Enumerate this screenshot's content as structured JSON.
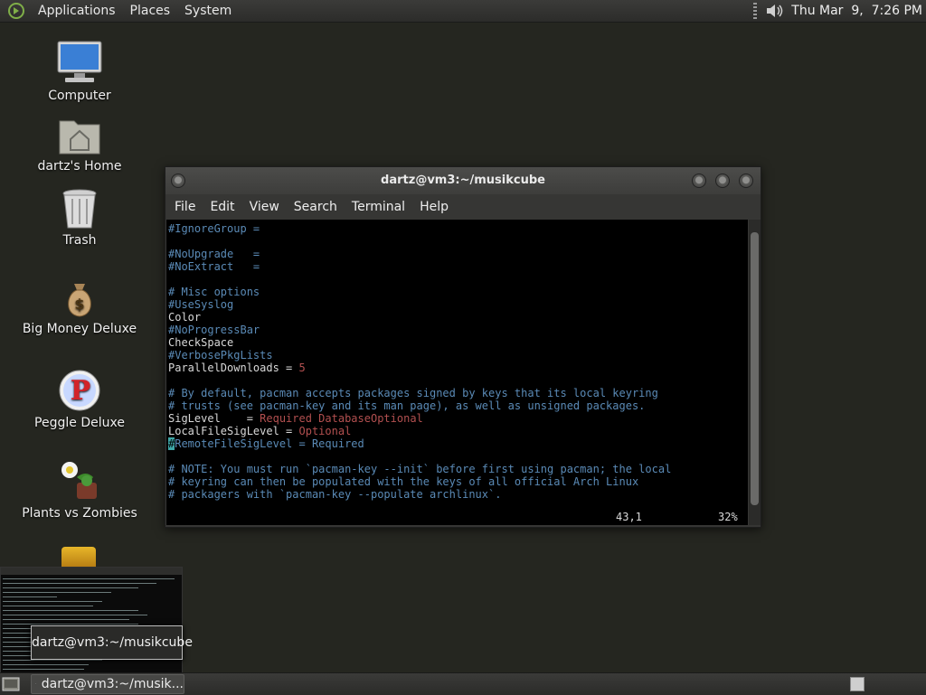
{
  "top_panel": {
    "menus": [
      "Applications",
      "Places",
      "System"
    ],
    "clock": "Thu Mar  9,  7:26 PM",
    "icons": [
      "gnome-foot-icon",
      "volume-icon"
    ]
  },
  "desktop": {
    "icons": [
      {
        "label": "Computer",
        "icon": "computer-icon"
      },
      {
        "label": "dartz's Home",
        "icon": "home-folder-icon"
      },
      {
        "label": "Trash",
        "icon": "trash-icon"
      },
      {
        "label": "Big Money Deluxe",
        "icon": "money-bag-icon"
      },
      {
        "label": "Peggle Deluxe",
        "icon": "peggle-icon"
      },
      {
        "label": "Plants vs Zombies",
        "icon": "plants-vs-zombies-icon"
      }
    ]
  },
  "terminal": {
    "title": "dartz@vm3:~/musikcube",
    "menus": [
      "File",
      "Edit",
      "View",
      "Search",
      "Terminal",
      "Help"
    ],
    "lines": [
      {
        "t": "#IgnoreGroup =",
        "c": "blue"
      },
      {
        "t": "",
        "c": "blue"
      },
      {
        "t": "#NoUpgrade   =",
        "c": "blue"
      },
      {
        "t": "#NoExtract   =",
        "c": "blue"
      },
      {
        "t": "",
        "c": "blue"
      },
      {
        "t": "# Misc options",
        "c": "blue"
      },
      {
        "t": "#UseSyslog",
        "c": "blue"
      },
      {
        "t": "Color",
        "c": "white"
      },
      {
        "t": "#NoProgressBar",
        "c": "blue"
      },
      {
        "t": "CheckSpace",
        "c": "white"
      },
      {
        "t": "#VerbosePkgLists",
        "c": "blue"
      },
      {
        "parts": [
          {
            "t": "ParallelDownloads = ",
            "c": "white"
          },
          {
            "t": "5",
            "c": "red"
          }
        ]
      },
      {
        "t": "",
        "c": "blue"
      },
      {
        "t": "# By default, pacman accepts packages signed by keys that its local keyring",
        "c": "blue"
      },
      {
        "t": "# trusts (see pacman-key and its man page), as well as unsigned packages.",
        "c": "blue"
      },
      {
        "parts": [
          {
            "t": "SigLevel    = ",
            "c": "white"
          },
          {
            "t": "Required DatabaseOptional",
            "c": "red"
          }
        ]
      },
      {
        "parts": [
          {
            "t": "LocalFileSigLevel = ",
            "c": "white"
          },
          {
            "t": "Optional",
            "c": "red"
          }
        ]
      },
      {
        "parts": [
          {
            "t": "#",
            "c": "cursor"
          },
          {
            "t": "RemoteFileSigLevel = Required",
            "c": "blue"
          }
        ]
      },
      {
        "t": "",
        "c": "blue"
      },
      {
        "t": "# NOTE: You must run `pacman-key --init` before first using pacman; the local",
        "c": "blue"
      },
      {
        "t": "# keyring can then be populated with the keys of all official Arch Linux",
        "c": "blue"
      },
      {
        "t": "# packagers with `pacman-key --populate archlinux`.",
        "c": "blue"
      }
    ],
    "status_position": "43,1",
    "status_percent": "32%"
  },
  "preview_tooltip": "dartz@vm3:~/musikcube",
  "bottom_panel": {
    "task_label": "dartz@vm3:~/musik..."
  },
  "colors": {
    "desktop_bg": "#252620",
    "comment": "#5a8ab6",
    "value": "#b35050",
    "cursor": "#3ea7a7"
  }
}
